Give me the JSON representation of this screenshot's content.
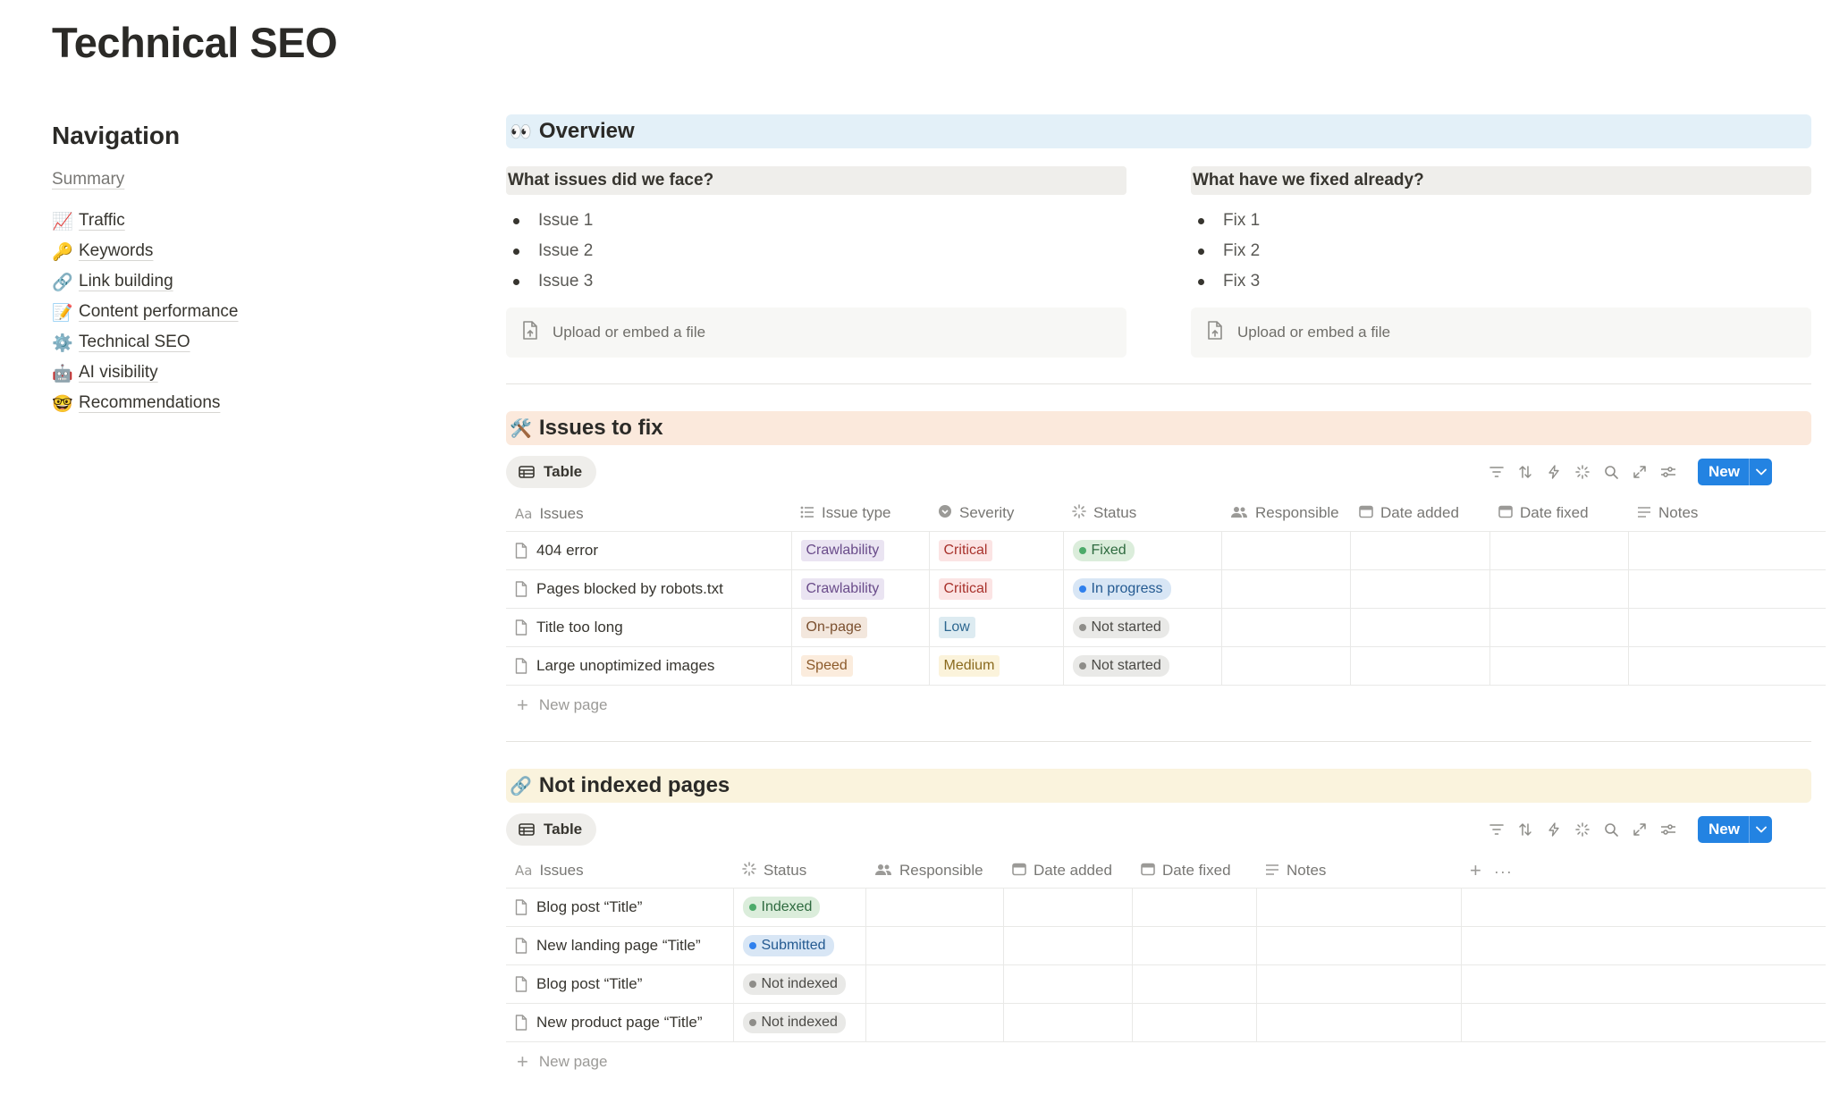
{
  "page": {
    "title": "Technical SEO"
  },
  "navigation": {
    "heading": "Navigation",
    "summary": "Summary",
    "items": [
      {
        "emoji": "📈",
        "label": "Traffic"
      },
      {
        "emoji": "🔑",
        "label": "Keywords"
      },
      {
        "emoji": "🔗",
        "label": "Link building"
      },
      {
        "emoji": "📝",
        "label": "Content performance"
      },
      {
        "emoji": "⚙️",
        "label": "Technical SEO"
      },
      {
        "emoji": "🤖",
        "label": "AI visibility"
      },
      {
        "emoji": "🤓",
        "label": "Recommendations"
      }
    ]
  },
  "overview": {
    "emoji": "👀",
    "title": "Overview",
    "left": {
      "heading": "What issues did we face?",
      "items": [
        "Issue 1",
        "Issue  2",
        "Issue  3"
      ],
      "upload": "Upload or embed a file"
    },
    "right": {
      "heading": "What have we fixed already?",
      "items": [
        "Fix 1",
        "Fix 2",
        "Fix 3"
      ],
      "upload": "Upload or embed a file"
    }
  },
  "issues": {
    "emoji": "🛠️",
    "title": "Issues to fix",
    "view_label": "Table",
    "new_label": "New",
    "columns": [
      "Issues",
      "Issue type",
      "Severity",
      "Status",
      "Responsible",
      "Date added",
      "Date fixed",
      "Notes"
    ],
    "rows": [
      {
        "name": "404 error",
        "type": "Crawlability",
        "severity": "Critical",
        "status": "Fixed"
      },
      {
        "name": "Pages blocked by robots.txt",
        "type": "Crawlability",
        "severity": "Critical",
        "status": "In progress"
      },
      {
        "name": "Title too long",
        "type": "On-page",
        "severity": "Low",
        "status": "Not started"
      },
      {
        "name": "Large unoptimized images",
        "type": "Speed",
        "severity": "Medium",
        "status": "Not started"
      }
    ],
    "new_page": "New page"
  },
  "not_indexed": {
    "emoji": "🔗",
    "title": "Not indexed pages",
    "view_label": "Table",
    "new_label": "New",
    "columns": [
      "Issues",
      "Status",
      "Responsible",
      "Date added",
      "Date fixed",
      "Notes"
    ],
    "rows": [
      {
        "name": "Blog post “Title”",
        "status": "Indexed"
      },
      {
        "name": "New landing page “Title”",
        "status": "Submitted"
      },
      {
        "name": "Blog post “Title”",
        "status": "Not indexed"
      },
      {
        "name": "New product page “Title”",
        "status": "Not indexed"
      }
    ],
    "new_page": "New page"
  },
  "colors": {
    "accent": "#2383e2",
    "tag_purple_bg": "#eae4f2",
    "tag_purple_fg": "#6a4c8a",
    "tag_red_bg": "#fbe4e4",
    "tag_red_fg": "#a8322c",
    "tag_orange_bg": "#fbecdd",
    "tag_orange_fg": "#8c5a2a",
    "tag_yellow_bg": "#fbf3db",
    "tag_yellow_fg": "#8a6a1e",
    "tag_blue_bg": "#ddebf1",
    "tag_blue_fg": "#2d6790",
    "status_green": "#4dab6a",
    "status_blue": "#2f80ed",
    "status_gray": "#8e8d89"
  }
}
